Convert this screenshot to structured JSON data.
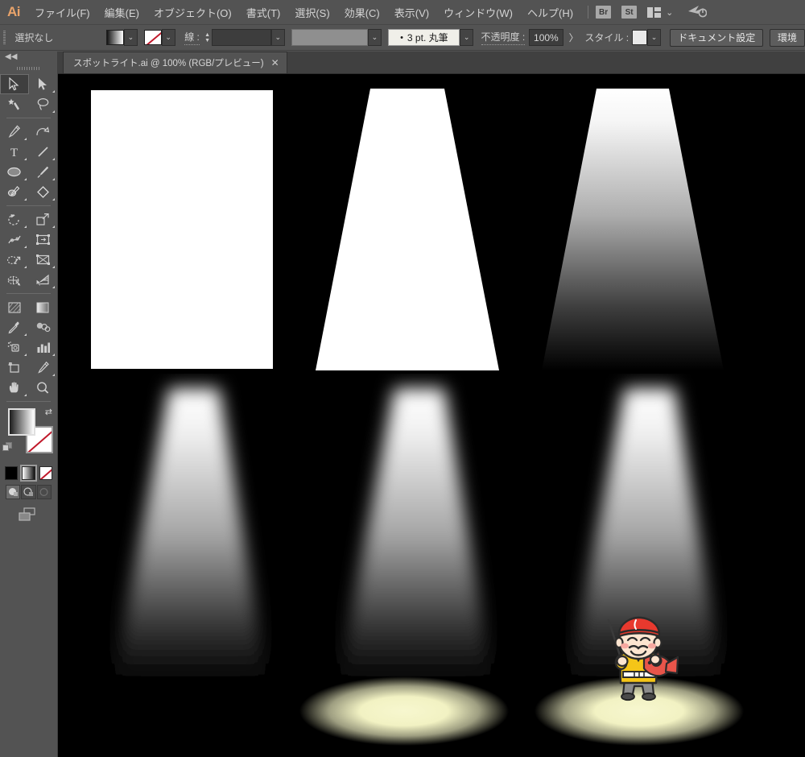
{
  "app": {
    "name": "Adobe Illustrator",
    "logo_text": "Ai"
  },
  "menubar": {
    "items": [
      {
        "label": "ファイル(F)",
        "name": "menu-file"
      },
      {
        "label": "編集(E)",
        "name": "menu-edit"
      },
      {
        "label": "オブジェクト(O)",
        "name": "menu-object"
      },
      {
        "label": "書式(T)",
        "name": "menu-type"
      },
      {
        "label": "選択(S)",
        "name": "menu-select"
      },
      {
        "label": "効果(C)",
        "name": "menu-effect"
      },
      {
        "label": "表示(V)",
        "name": "menu-view"
      },
      {
        "label": "ウィンドウ(W)",
        "name": "menu-window"
      },
      {
        "label": "ヘルプ(H)",
        "name": "menu-help"
      }
    ],
    "bridge_button": "Br",
    "stock_button": "St",
    "workspace_label": ""
  },
  "controlbar": {
    "selection_status": "選択なし",
    "fill_swatch_label": "",
    "stroke_swatch_label": "",
    "stroke_label": "線 :",
    "stroke_weight_value": "",
    "stroke_profile_value": "",
    "brush_value": "3 pt. 丸筆",
    "opacity_label": "不透明度 :",
    "opacity_value": "100%",
    "opacity_more": "〉",
    "style_label": "スタイル :",
    "document_setup_button": "ドキュメント設定",
    "preferences_button": "環境"
  },
  "tab": {
    "title": "スポットライト.ai @ 100% (RGB/プレビュー)",
    "close": "✕"
  },
  "toolbar": {
    "collapse": "◀◀",
    "tools": [
      {
        "name": "selection-tool",
        "label": "選択ツール",
        "selected": true
      },
      {
        "name": "direct-selection-tool",
        "label": "ダイレクト選択ツール",
        "selected": false
      },
      {
        "name": "magic-wand-tool",
        "label": "自動選択ツール",
        "selected": false
      },
      {
        "name": "lasso-tool",
        "label": "なげなわツール",
        "selected": false
      },
      {
        "name": "pen-tool",
        "label": "ペンツール",
        "selected": false
      },
      {
        "name": "curvature-tool",
        "label": "曲線ツール",
        "selected": false
      },
      {
        "name": "type-tool",
        "label": "文字ツール",
        "selected": false
      },
      {
        "name": "line-segment-tool",
        "label": "直線ツール",
        "selected": false
      },
      {
        "name": "ellipse-tool",
        "label": "楕円形ツール",
        "selected": false
      },
      {
        "name": "paintbrush-tool",
        "label": "ブラシツール",
        "selected": false
      },
      {
        "name": "shaper-tool",
        "label": "Shaper ツール",
        "selected": false
      },
      {
        "name": "eraser-tool",
        "label": "消しゴムツール",
        "selected": false
      },
      {
        "name": "rotate-tool",
        "label": "回転ツール",
        "selected": false
      },
      {
        "name": "scale-tool",
        "label": "拡大・縮小ツール",
        "selected": false
      },
      {
        "name": "width-tool",
        "label": "線幅ツール",
        "selected": false
      },
      {
        "name": "free-transform-tool",
        "label": "自由変形ツール",
        "selected": false
      },
      {
        "name": "shape-builder-tool",
        "label": "シェイプ形成ツール",
        "selected": false
      },
      {
        "name": "perspective-grid-tool",
        "label": "遠近グリッドツール",
        "selected": false
      },
      {
        "name": "mesh-tool",
        "label": "メッシュツール",
        "selected": false
      },
      {
        "name": "gradient-tool",
        "label": "グラデーションツール",
        "selected": false
      },
      {
        "name": "eyedropper-tool",
        "label": "スポイトツール",
        "selected": false
      },
      {
        "name": "blend-tool",
        "label": "ブレンドツール",
        "selected": false
      },
      {
        "name": "symbol-sprayer-tool",
        "label": "シンボルスプレーツール",
        "selected": false
      },
      {
        "name": "column-graph-tool",
        "label": "グラフツール",
        "selected": false
      },
      {
        "name": "artboard-tool",
        "label": "アートボードツール",
        "selected": false
      },
      {
        "name": "slice-tool",
        "label": "スライスツール",
        "selected": false
      },
      {
        "name": "hand-tool",
        "label": "手のひらツール",
        "selected": false
      },
      {
        "name": "zoom-tool",
        "label": "ズームツール",
        "selected": false
      }
    ],
    "fill_color": "#ffffff",
    "stroke_color": "none",
    "fill_modes": [
      {
        "name": "color-fill-button",
        "label": "カラー"
      },
      {
        "name": "gradient-fill-button",
        "label": "グラデーション"
      },
      {
        "name": "none-fill-button",
        "label": "なし"
      }
    ],
    "screen_modes": [
      {
        "name": "normal-screen-mode",
        "label": "標準スクリーンモード"
      },
      {
        "name": "full-screen-menubar-mode",
        "label": "メニュー付きフルスクリーン"
      },
      {
        "name": "full-screen-mode",
        "label": "フルスクリーン"
      }
    ]
  },
  "canvas": {
    "background": "#000000",
    "artwork_title": "スポットライト",
    "shapes": [
      {
        "name": "rect-white",
        "kind": "rectangle",
        "fill": "#ffffff",
        "note": "step 1 - plain white rectangle"
      },
      {
        "name": "trapezoid-white",
        "kind": "trapezoid",
        "fill": "#ffffff",
        "note": "step 2 - tapered cone"
      },
      {
        "name": "trapezoid-gradient",
        "kind": "trapezoid",
        "fill": "linear-gradient white to black",
        "note": "step 3 - gradient fill"
      },
      {
        "name": "trapezoid-gradient-blur",
        "kind": "trapezoid",
        "fill": "linear-gradient white to black",
        "note": "step 4 - gaussian blur"
      },
      {
        "name": "trapezoid-blur-with-pool",
        "kind": "trapezoid",
        "fill": "linear-gradient white to black",
        "note": "step 5 - blur plus floor pool"
      },
      {
        "name": "trapezoid-blur-with-subject",
        "kind": "trapezoid",
        "fill": "linear-gradient white to black",
        "note": "step 6 - final with subject"
      }
    ],
    "light_pool_color": "#f2f2c0",
    "character": {
      "name": "ebisu-character",
      "label": "恵比寿",
      "hat_color": "#e8392e",
      "robe_color": "#f5c518",
      "pants_color": "#8c8c8c",
      "fish_color": "#e8554a",
      "skin_color": "#fde5d0"
    }
  }
}
